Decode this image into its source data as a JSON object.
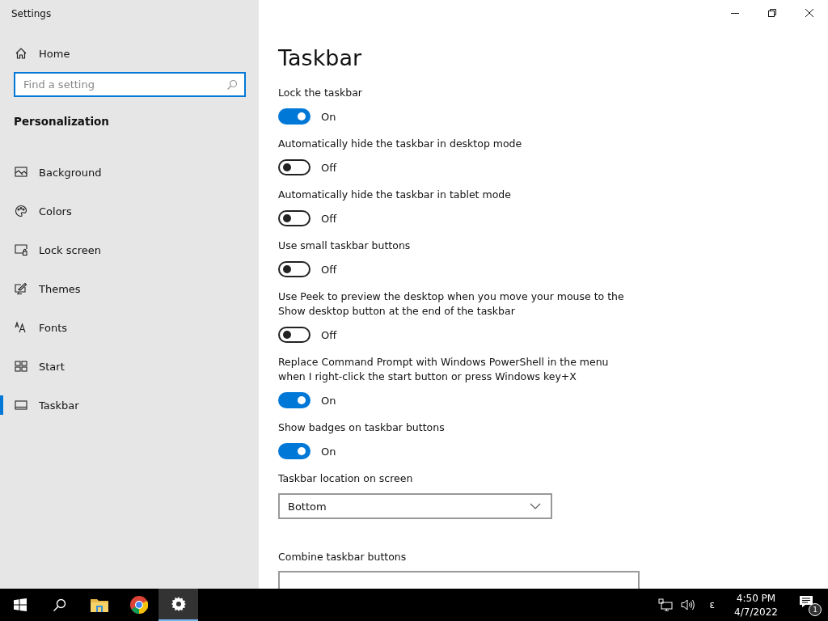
{
  "window": {
    "title": "Settings",
    "controls": [
      {
        "kind": "minimize"
      },
      {
        "kind": "restore"
      },
      {
        "kind": "close"
      }
    ]
  },
  "sidebar": {
    "home": {
      "label": "Home"
    },
    "search": {
      "placeholder": "Find a setting"
    },
    "section": "Personalization",
    "items": [
      {
        "label": "Background",
        "selected": false
      },
      {
        "label": "Colors",
        "selected": false
      },
      {
        "label": "Lock screen",
        "selected": false
      },
      {
        "label": "Themes",
        "selected": false
      },
      {
        "label": "Fonts",
        "selected": false
      },
      {
        "label": "Start",
        "selected": false
      },
      {
        "label": "Taskbar",
        "selected": true
      }
    ]
  },
  "page": {
    "title": "Taskbar",
    "settings": [
      {
        "kind": "toggle",
        "label": "Lock the taskbar",
        "on": true,
        "state": "On"
      },
      {
        "kind": "toggle",
        "label": "Automatically hide the taskbar in desktop mode",
        "on": false,
        "state": "Off"
      },
      {
        "kind": "toggle",
        "label": "Automatically hide the taskbar in tablet mode",
        "on": false,
        "state": "Off"
      },
      {
        "kind": "toggle",
        "label": "Use small taskbar buttons",
        "on": false,
        "state": "Off"
      },
      {
        "kind": "toggle",
        "label": "Use Peek to preview the desktop when you move your mouse to the Show desktop button at the end of the taskbar",
        "on": false,
        "state": "Off"
      },
      {
        "kind": "toggle",
        "label": "Replace Command Prompt with Windows PowerShell in the menu when I right-click the start button or press Windows key+X",
        "on": true,
        "state": "On"
      },
      {
        "kind": "toggle",
        "label": "Show badges on taskbar buttons",
        "on": true,
        "state": "On"
      },
      {
        "kind": "dropdown",
        "label": "Taskbar location on screen",
        "value": "Bottom"
      },
      {
        "kind": "dropdown",
        "label": "Combine taskbar buttons"
      }
    ]
  },
  "taskbar": {
    "apps": [
      {
        "selected": false
      },
      {
        "selected": false
      },
      {
        "selected": false
      },
      {
        "selected": false
      },
      {
        "selected": true
      }
    ],
    "language": "ε",
    "time": "4:50 PM",
    "date": "4/7/2022",
    "notifications": "1"
  }
}
